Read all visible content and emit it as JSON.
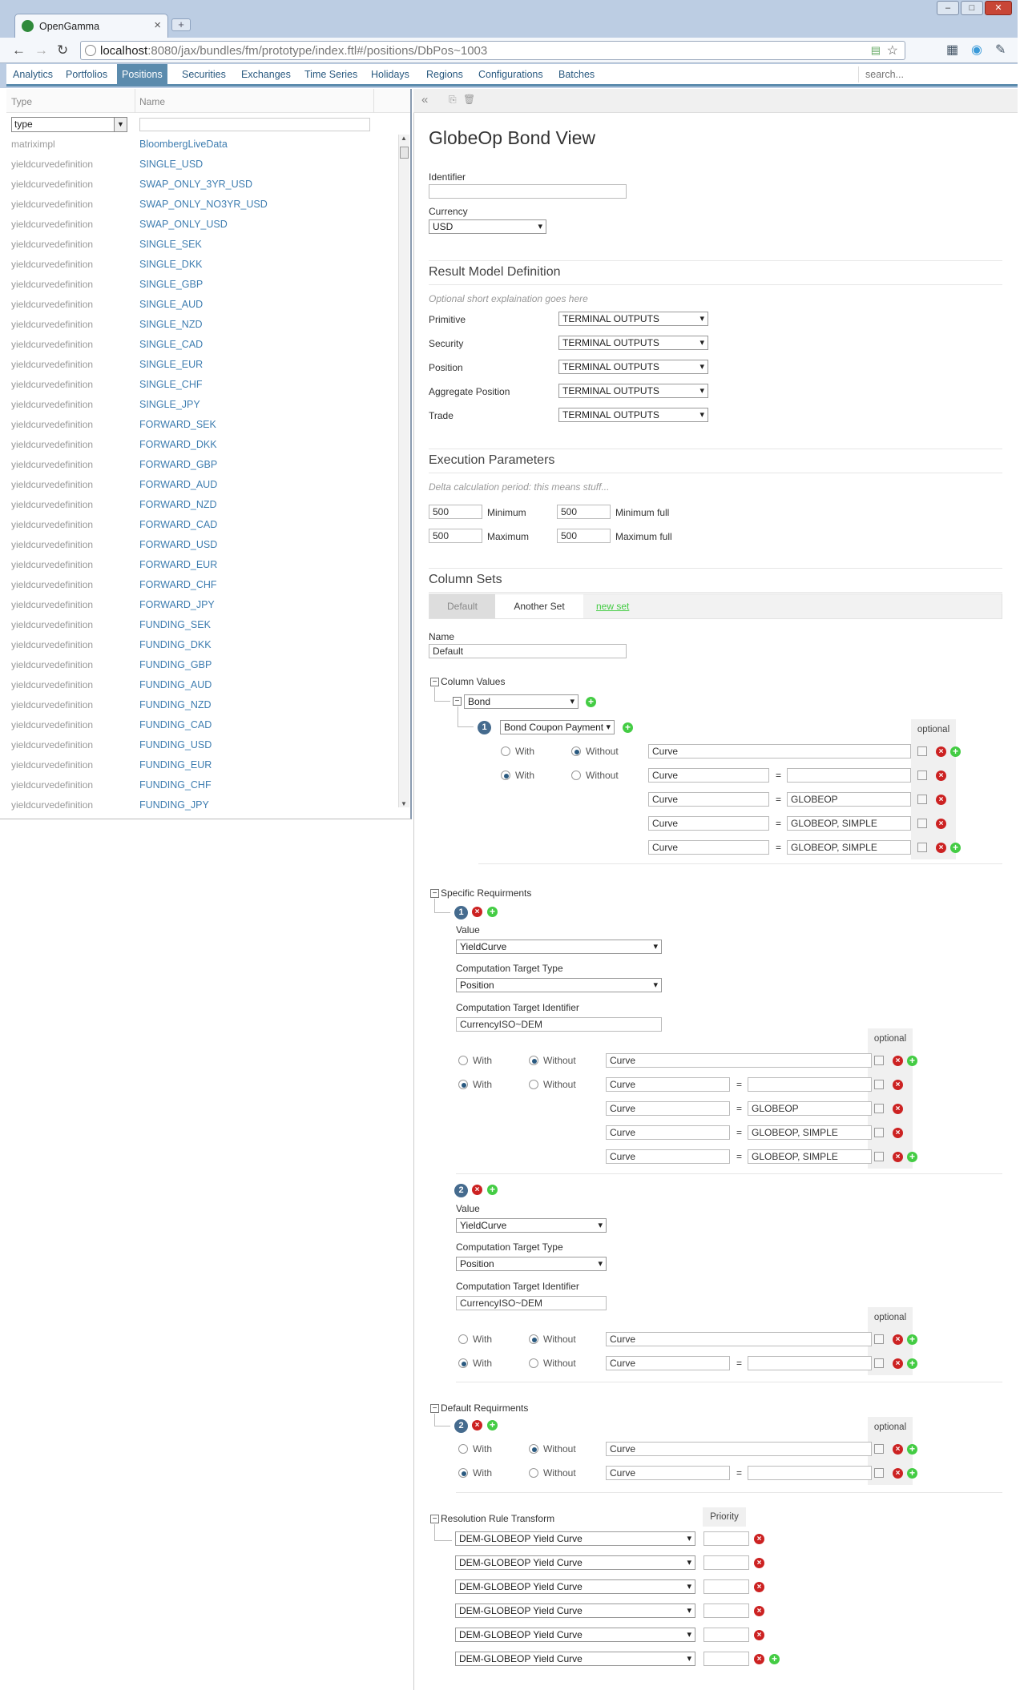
{
  "browser": {
    "tab_title": "OpenGamma",
    "url_host": "localhost",
    "url_rest": ":8080/jax/bundles/fm/prototype/index.ftl#/positions/DbPos~1003"
  },
  "nav": {
    "items": [
      "Analytics",
      "Portfolios",
      "Positions",
      "Securities",
      "Exchanges",
      "Time Series",
      "Holidays",
      "Regions",
      "Configurations",
      "Batches"
    ],
    "active": "Positions",
    "search_placeholder": "search..."
  },
  "left": {
    "col_type": "Type",
    "col_name": "Name",
    "type_filter": "type",
    "rows": [
      {
        "type": "matriximpl",
        "name": "BloombergLiveData"
      },
      {
        "type": "yieldcurvedefinition",
        "name": "SINGLE_USD"
      },
      {
        "type": "yieldcurvedefinition",
        "name": "SWAP_ONLY_3YR_USD"
      },
      {
        "type": "yieldcurvedefinition",
        "name": "SWAP_ONLY_NO3YR_USD"
      },
      {
        "type": "yieldcurvedefinition",
        "name": "SWAP_ONLY_USD"
      },
      {
        "type": "yieldcurvedefinition",
        "name": "SINGLE_SEK"
      },
      {
        "type": "yieldcurvedefinition",
        "name": "SINGLE_DKK"
      },
      {
        "type": "yieldcurvedefinition",
        "name": "SINGLE_GBP"
      },
      {
        "type": "yieldcurvedefinition",
        "name": "SINGLE_AUD"
      },
      {
        "type": "yieldcurvedefinition",
        "name": "SINGLE_NZD"
      },
      {
        "type": "yieldcurvedefinition",
        "name": "SINGLE_CAD"
      },
      {
        "type": "yieldcurvedefinition",
        "name": "SINGLE_EUR"
      },
      {
        "type": "yieldcurvedefinition",
        "name": "SINGLE_CHF"
      },
      {
        "type": "yieldcurvedefinition",
        "name": "SINGLE_JPY"
      },
      {
        "type": "yieldcurvedefinition",
        "name": "FORWARD_SEK"
      },
      {
        "type": "yieldcurvedefinition",
        "name": "FORWARD_DKK"
      },
      {
        "type": "yieldcurvedefinition",
        "name": "FORWARD_GBP"
      },
      {
        "type": "yieldcurvedefinition",
        "name": "FORWARD_AUD"
      },
      {
        "type": "yieldcurvedefinition",
        "name": "FORWARD_NZD"
      },
      {
        "type": "yieldcurvedefinition",
        "name": "FORWARD_CAD"
      },
      {
        "type": "yieldcurvedefinition",
        "name": "FORWARD_USD"
      },
      {
        "type": "yieldcurvedefinition",
        "name": "FORWARD_EUR"
      },
      {
        "type": "yieldcurvedefinition",
        "name": "FORWARD_CHF"
      },
      {
        "type": "yieldcurvedefinition",
        "name": "FORWARD_JPY"
      },
      {
        "type": "yieldcurvedefinition",
        "name": "FUNDING_SEK"
      },
      {
        "type": "yieldcurvedefinition",
        "name": "FUNDING_DKK"
      },
      {
        "type": "yieldcurvedefinition",
        "name": "FUNDING_GBP"
      },
      {
        "type": "yieldcurvedefinition",
        "name": "FUNDING_AUD"
      },
      {
        "type": "yieldcurvedefinition",
        "name": "FUNDING_NZD"
      },
      {
        "type": "yieldcurvedefinition",
        "name": "FUNDING_CAD"
      },
      {
        "type": "yieldcurvedefinition",
        "name": "FUNDING_USD"
      },
      {
        "type": "yieldcurvedefinition",
        "name": "FUNDING_EUR"
      },
      {
        "type": "yieldcurvedefinition",
        "name": "FUNDING_CHF"
      },
      {
        "type": "yieldcurvedefinition",
        "name": "FUNDING_JPY"
      }
    ]
  },
  "view": {
    "title": "GlobeOp Bond View",
    "identifier_label": "Identifier",
    "identifier_value": "",
    "currency_label": "Currency",
    "currency_value": "USD",
    "rmd": {
      "title": "Result Model Definition",
      "hint": "Optional short explaination goes here",
      "rows": [
        {
          "label": "Primitive",
          "value": "TERMINAL OUTPUTS"
        },
        {
          "label": "Security",
          "value": "TERMINAL OUTPUTS"
        },
        {
          "label": "Position",
          "value": "TERMINAL OUTPUTS"
        },
        {
          "label": "Aggregate Position",
          "value": "TERMINAL OUTPUTS"
        },
        {
          "label": "Trade",
          "value": "TERMINAL OUTPUTS"
        }
      ]
    },
    "exec": {
      "title": "Execution Parameters",
      "hint": "Delta calculation period: this means stuff...",
      "min": "500",
      "min_label": "Minimum",
      "min_full": "500",
      "min_full_label": "Minimum full",
      "max": "500",
      "max_label": "Maximum",
      "max_full": "500",
      "max_full_label": "Maximum full"
    },
    "colsets": {
      "title": "Column Sets",
      "tab_default": "Default",
      "tab_another": "Another Set",
      "new_set": "new set",
      "name_label": "Name",
      "name_value": "Default",
      "column_values": "Column Values",
      "security": "Bond",
      "value": "Bond Coupon Payment"
    },
    "optional": "optional",
    "with": "With",
    "without": "Without",
    "curve": "Curve",
    "globeop": "GLOBEOP",
    "globeop_simple": "GLOBEOP, SIMPLE",
    "specific": {
      "title": "Specific Requirments",
      "value_label": "Value",
      "value": "YieldCurve",
      "ctt_label": "Computation Target Type",
      "ctt": "Position",
      "cti_label": "Computation Target Identifier",
      "cti": "CurrencyISO~DEM",
      "n1": "1",
      "n2": "2"
    },
    "default": {
      "title": "Default Requirments",
      "n": "2"
    },
    "resolution": {
      "title": "Resolution Rule Transform",
      "priority": "Priority",
      "items": [
        "DEM-GLOBEOP Yield Curve",
        "DEM-GLOBEOP Yield Curve",
        "DEM-GLOBEOP Yield Curve",
        "DEM-GLOBEOP Yield Curve",
        "DEM-GLOBEOP Yield Curve",
        "DEM-GLOBEOP Yield Curve"
      ]
    }
  }
}
